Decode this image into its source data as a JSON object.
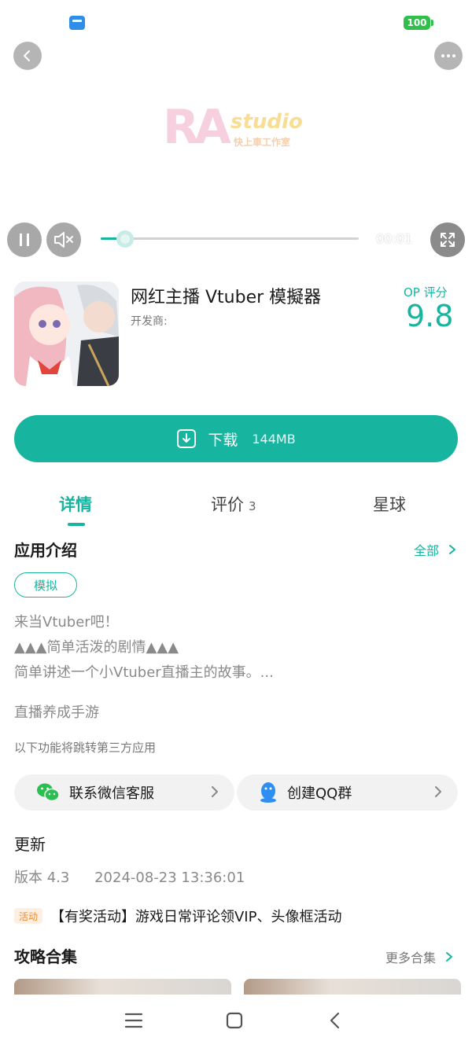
{
  "status_bar": {
    "battery": "100"
  },
  "video": {
    "logo_main": "RA",
    "logo_studio": "studio",
    "logo_sub": "快上車工作室",
    "time": "00:01",
    "progress": 0.06
  },
  "app": {
    "name": "网红主播 Vtuber 模擬器",
    "developer_label": "开发商:",
    "score_label": "OP 评分",
    "score": "9.8"
  },
  "download": {
    "label": "下载",
    "size": "144MB"
  },
  "tabs": [
    {
      "label": "详情",
      "active": true
    },
    {
      "label": "评价",
      "count": "3"
    },
    {
      "label": "星球"
    }
  ],
  "intro": {
    "title": "应用介绍",
    "more": "全部",
    "tag": "模拟",
    "lines": [
      "来当Vtuber吧！",
      "▲▲▲简单活泼的剧情▲▲▲",
      "简单讲述一个小Vtuber直播主的故事。..."
    ],
    "genre": "直播养成手游",
    "third_party_note": "以下功能将跳转第三方应用"
  },
  "services": [
    {
      "label": "联系微信客服",
      "icon": "wechat-icon"
    },
    {
      "label": "创建QQ群",
      "icon": "qq-icon"
    }
  ],
  "update": {
    "title": "更新",
    "version": "版本 4.3",
    "date": "2024-08-23 13:36:01"
  },
  "activity": {
    "badge": "活动",
    "text": "【有奖活动】游戏日常评论领VIP、头像框活动"
  },
  "guides": {
    "title": "攻略合集",
    "more": "更多合集"
  },
  "colors": {
    "accent": "#17b59f",
    "battery": "#2fbf4a",
    "activity": "#f08a2b"
  }
}
